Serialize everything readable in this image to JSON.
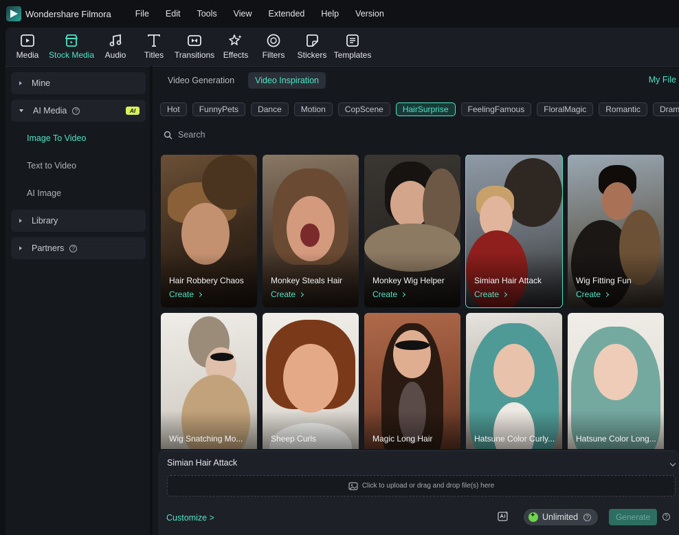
{
  "app": {
    "name": "Wondershare Filmora"
  },
  "menu": [
    "File",
    "Edit",
    "Tools",
    "View",
    "Extended",
    "Help",
    "Version"
  ],
  "toolbar": [
    {
      "label": "Media",
      "icon": "media-icon"
    },
    {
      "label": "Stock Media",
      "icon": "stock-media-icon",
      "active": true
    },
    {
      "label": "Audio",
      "icon": "music-note-icon"
    },
    {
      "label": "Titles",
      "icon": "titles-icon"
    },
    {
      "label": "Transitions",
      "icon": "transitions-icon"
    },
    {
      "label": "Effects",
      "icon": "effects-icon"
    },
    {
      "label": "Filters",
      "icon": "filters-icon"
    },
    {
      "label": "Stickers",
      "icon": "stickers-icon"
    },
    {
      "label": "Templates",
      "icon": "templates-icon"
    }
  ],
  "sidebar": {
    "mine": "Mine",
    "ai_media": "AI Media",
    "ai_badge": "AI",
    "sub_items": [
      "Image To Video",
      "Text to Video",
      "AI Image"
    ],
    "library": "Library",
    "partners": "Partners",
    "help_glyph": "?"
  },
  "main": {
    "tabs": [
      {
        "label": "Video Generation",
        "active": false
      },
      {
        "label": "Video Inspiration",
        "active": true
      }
    ],
    "my_file": "My File",
    "categories": [
      "Hot",
      "FunnyPets",
      "Dance",
      "Motion",
      "CopScene",
      "HairSurprise",
      "FeelingFamous",
      "FloralMagic",
      "Romantic",
      "Drama"
    ],
    "active_category": "HairSurprise",
    "search_placeholder": "Search",
    "create_label": "Create",
    "cards": [
      {
        "title": "Hair Robbery Chaos",
        "create": true
      },
      {
        "title": "Monkey Steals Hair",
        "create": true
      },
      {
        "title": "Monkey Wig Helper",
        "create": true
      },
      {
        "title": "Simian Hair Attack",
        "create": true,
        "selected": true
      },
      {
        "title": "Wig Fitting Fun",
        "create": true
      },
      {
        "title": "Wig Snatching Mo...",
        "create": false
      },
      {
        "title": "Sheep Curls",
        "create": false
      },
      {
        "title": "Magic Long Hair",
        "create": false
      },
      {
        "title": "Hatsune Color Curly...",
        "create": false
      },
      {
        "title": "Hatsune Color Long...",
        "create": false
      }
    ]
  },
  "panel": {
    "title": "Simian Hair Attack",
    "upload_text": "Click to upload or drag and drop file(s) here",
    "customize": "Customize >",
    "unlimited": "Unlimited",
    "generate": "Generate",
    "help_glyph": "?"
  },
  "colors": {
    "accent": "#4fe3c7",
    "background": "#0f1115",
    "panel": "#15181d",
    "ai_badge": "#d7f25a"
  }
}
